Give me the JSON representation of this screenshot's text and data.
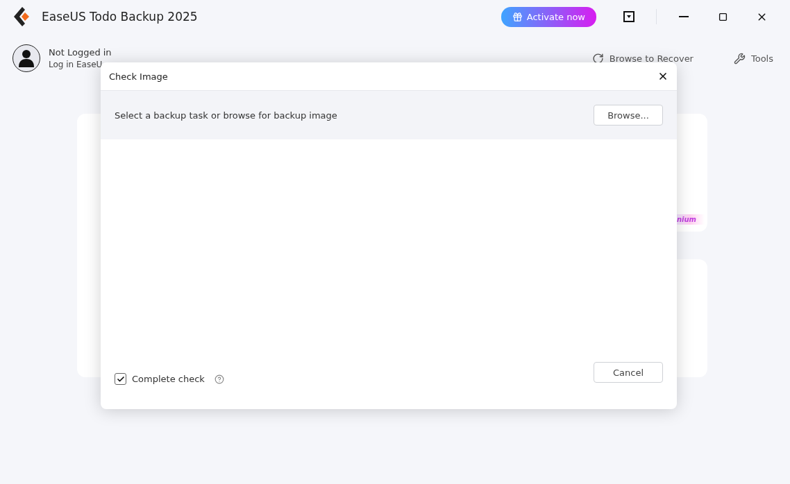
{
  "window": {
    "title": "EaseUS Todo Backup 2025",
    "activate_button": "Activate now"
  },
  "account": {
    "name": "Not Logged in",
    "hint": "Log in EaseU"
  },
  "nav": [
    {
      "label": "Browse to Recover",
      "kind": "recover"
    },
    {
      "label": "Tools",
      "kind": "tools"
    }
  ],
  "background_card": {
    "badge": "nium"
  },
  "dialog": {
    "title": "Check Image",
    "prompt": "Select a backup task or browse for backup image",
    "browse_button": "Browse...",
    "complete_check": {
      "label": "Complete check",
      "checked": true
    },
    "cancel_button": "Cancel"
  }
}
